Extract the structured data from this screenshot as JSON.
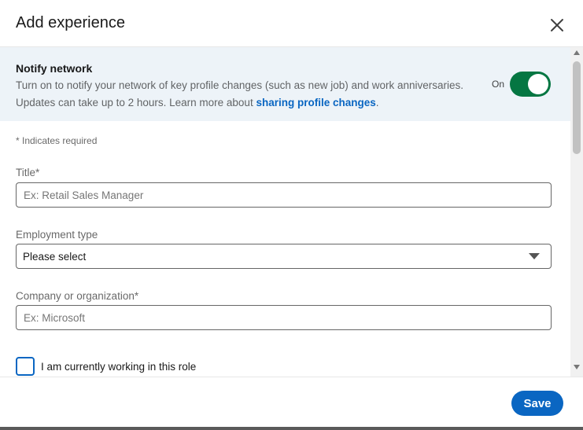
{
  "dialog": {
    "title": "Add experience",
    "close_icon": "close-icon"
  },
  "notify": {
    "title": "Notify network",
    "description_line1": "Turn on to notify your network of key profile changes (such as new job) and work anniversaries.",
    "description_line2": "Updates can take up to 2 hours. Learn more about ",
    "link_text": "sharing profile changes",
    "after_link": ".",
    "toggle_label": "On",
    "toggle_on": true,
    "toggle_color": "#057642"
  },
  "form": {
    "required_note": "* Indicates required",
    "title_label": "Title*",
    "title_placeholder": "Ex: Retail Sales Manager",
    "title_value": "",
    "employment_label": "Employment type",
    "employment_value": "Please select",
    "company_label": "Company or organization*",
    "company_placeholder": "Ex: Microsoft",
    "company_value": "",
    "currently_working_label": "I am currently working in this role",
    "currently_working_checked": false
  },
  "footer": {
    "save_label": "Save",
    "accent_color": "#0a66c2"
  }
}
